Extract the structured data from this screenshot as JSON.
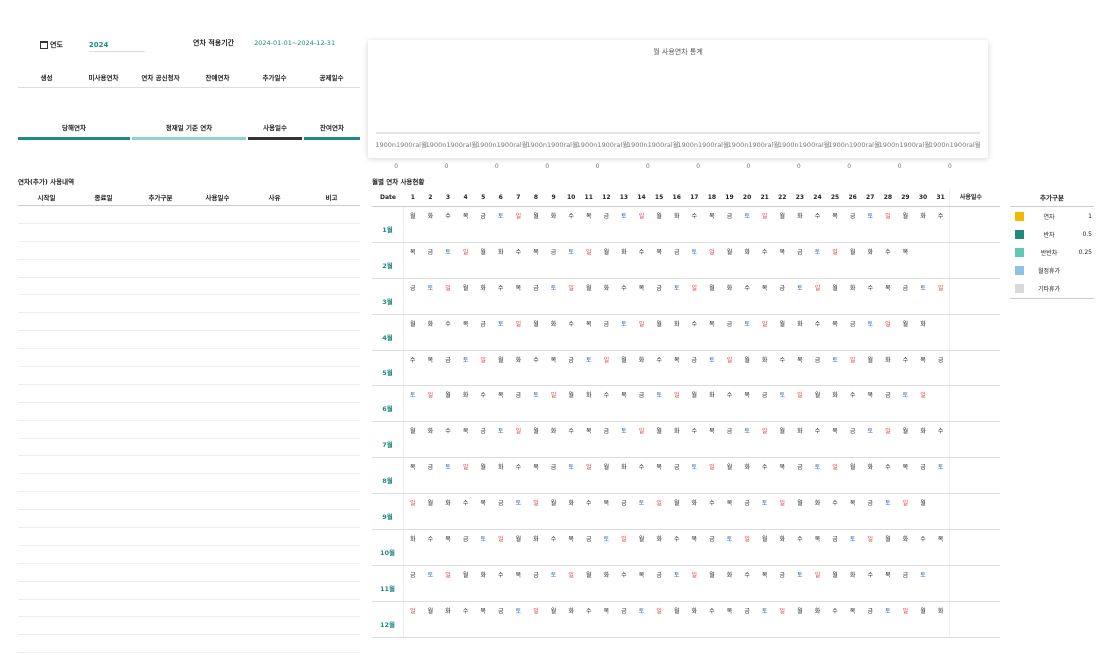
{
  "filters": {
    "year_label": "연도",
    "year_value": "2024",
    "period_label": "연차 적용기간",
    "period_value": "2024-01-01~2024-12-31"
  },
  "summary_headers": [
    "생성",
    "미사용연차",
    "연차 공신청자",
    "잔예연차",
    "추가일수",
    "공제일수"
  ],
  "tabs": [
    "당해연차",
    "정재일 기준 연차",
    "사용일수",
    "잔여연차"
  ],
  "history": {
    "title": "연차(추가) 사용내역",
    "headers": [
      "시작일",
      "종료일",
      "추가구분",
      "사용일수",
      "사유",
      "비고"
    ],
    "row_count": 25
  },
  "chart": {
    "title": "월 사용연차 통계",
    "category_label": "1900n1900ral월",
    "categories": [
      "1900n1900ral월",
      "1900n1900ral월",
      "1900n1900ral월",
      "1900n1900ral월",
      "1900n1900ral월",
      "1900n1900ral월",
      "1900n1900ral월",
      "1900n1900ral월",
      "1900n1900ral월",
      "1900n1900ral월",
      "1900n1900ral월",
      "1900n1900ral월"
    ],
    "values": [
      0,
      0,
      0,
      0,
      0,
      0,
      0,
      0,
      0,
      0,
      0,
      0
    ],
    "value_labels": [
      "0",
      "0",
      "0",
      "0",
      "0",
      "0",
      "0",
      "0",
      "0",
      "0",
      "0",
      "0"
    ]
  },
  "chart_data": {
    "type": "bar",
    "title": "월 사용연차 통계",
    "categories": [
      "1900n1900ral월",
      "1900n1900ral월",
      "1900n1900ral월",
      "1900n1900ral월",
      "1900n1900ral월",
      "1900n1900ral월",
      "1900n1900ral월",
      "1900n1900ral월",
      "1900n1900ral월",
      "1900n1900ral월",
      "1900n1900ral월",
      "1900n1900ral월"
    ],
    "values": [
      0,
      0,
      0,
      0,
      0,
      0,
      0,
      0,
      0,
      0,
      0,
      0
    ],
    "xlabel": "",
    "ylabel": "",
    "grid": false
  },
  "calendar": {
    "title": "월별 연차 사용현황",
    "date_header": "Date",
    "use_header": "사용일수",
    "days": [
      "1",
      "2",
      "3",
      "4",
      "5",
      "6",
      "7",
      "8",
      "9",
      "10",
      "11",
      "12",
      "13",
      "14",
      "15",
      "16",
      "17",
      "18",
      "19",
      "20",
      "21",
      "22",
      "23",
      "24",
      "25",
      "26",
      "27",
      "28",
      "29",
      "30",
      "31"
    ],
    "weekdays": [
      "월",
      "화",
      "수",
      "목",
      "금",
      "토",
      "일"
    ],
    "months": [
      {
        "label": "1월",
        "start": 0,
        "length": 31
      },
      {
        "label": "2월",
        "start": 3,
        "length": 29
      },
      {
        "label": "3월",
        "start": 4,
        "length": 31
      },
      {
        "label": "4월",
        "start": 0,
        "length": 30
      },
      {
        "label": "5월",
        "start": 2,
        "length": 31
      },
      {
        "label": "6월",
        "start": 5,
        "length": 30
      },
      {
        "label": "7월",
        "start": 0,
        "length": 31
      },
      {
        "label": "8월",
        "start": 3,
        "length": 31
      },
      {
        "label": "9월",
        "start": 6,
        "length": 30
      },
      {
        "label": "10월",
        "start": 1,
        "length": 31
      },
      {
        "label": "11월",
        "start": 4,
        "length": 30
      },
      {
        "label": "12월",
        "start": 6,
        "length": 31
      }
    ],
    "colors": {
      "saturday": "#2457c5",
      "sunday": "#e03030",
      "month_label": "#1f8a7f"
    }
  },
  "legend": {
    "title": "추가구분",
    "items": [
      {
        "label": "연차",
        "value": "1",
        "color": "#f5b800"
      },
      {
        "label": "반차",
        "value": "0.5",
        "color": "#1f8a7f"
      },
      {
        "label": "반반차",
        "value": "0.25",
        "color": "#5fc9b8"
      },
      {
        "label": "월정휴가",
        "value": "",
        "color": "#8ec3e6"
      },
      {
        "label": "기타휴가",
        "value": "",
        "color": "#d9d9d9"
      }
    ]
  }
}
